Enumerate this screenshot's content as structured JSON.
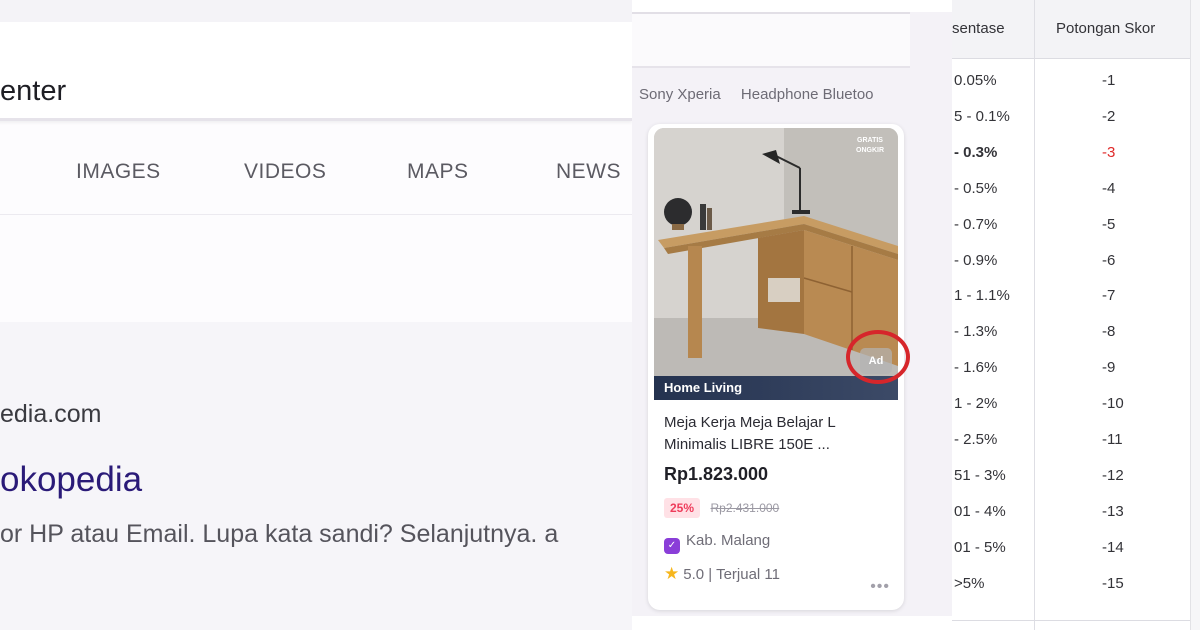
{
  "search_panel": {
    "query_text": "enter",
    "tabs": [
      "IMAGES",
      "VIDEOS",
      "MAPS",
      "NEWS"
    ],
    "result": {
      "url": "edia.com",
      "title": "okopedia",
      "snippet": "or HP atau Email. Lupa kata sandi? Selanjutnya. a"
    }
  },
  "marketplace": {
    "chips": [
      "Sony Xperia",
      "Headphone Bluetoo"
    ],
    "card": {
      "category": "Home Living",
      "free_shipping_badge": "GRATIS ONGKIR",
      "ad_label": "Ad",
      "name": "Meja Kerja Meja Belajar L Minimalis LIBRE 150E ...",
      "price": "Rp1.823.000",
      "discount": "25%",
      "original_price": "Rp2.431.000",
      "location": "Kab. Malang",
      "rating_text": "5.0 | Terjual 11",
      "more": "•••"
    },
    "colors": {
      "ad_highlight": "#d6262b",
      "shop_badge": "#8a3ed8",
      "star": "#f6b61d"
    }
  },
  "penalty_table": {
    "headers": {
      "percentage": "sentase",
      "score": "Potongan Skor"
    },
    "rows": [
      {
        "pct": "0.05%",
        "score": "-1"
      },
      {
        "pct": "5 - 0.1%",
        "score": "-2"
      },
      {
        "pct": "- 0.3%",
        "score": "-3",
        "highlight": true
      },
      {
        "pct": "- 0.5%",
        "score": "-4"
      },
      {
        "pct": "- 0.7%",
        "score": "-5"
      },
      {
        "pct": "- 0.9%",
        "score": "-6"
      },
      {
        "pct": "1 - 1.1%",
        "score": "-7"
      },
      {
        "pct": "- 1.3%",
        "score": "-8"
      },
      {
        "pct": "- 1.6%",
        "score": "-9"
      },
      {
        "pct": "1 - 2%",
        "score": "-10"
      },
      {
        "pct": "- 2.5%",
        "score": "-11"
      },
      {
        "pct": "51 - 3%",
        "score": "-12"
      },
      {
        "pct": "01 - 4%",
        "score": "-13"
      },
      {
        "pct": "01 - 5%",
        "score": "-14"
      },
      {
        "pct": ">5%",
        "score": "-15"
      }
    ],
    "colors": {
      "highlight_score": "#e02a2a"
    }
  }
}
